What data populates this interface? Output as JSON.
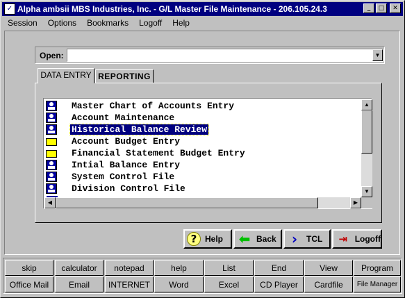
{
  "window": {
    "title": "Alpha ambsii MBS Industries, Inc. - G/L Master File Maintenance - 206.105.24.3",
    "minimize_glyph": "_",
    "maximize_glyph": "□",
    "close_glyph": "✕"
  },
  "menu": [
    "Session",
    "Options",
    "Bookmarks",
    "Logoff",
    "Help"
  ],
  "open": {
    "label": "Open:",
    "value": ""
  },
  "tabs": {
    "active": "DATA ENTRY",
    "inactive": "REPORTING"
  },
  "list": {
    "items": [
      {
        "label": "Master Chart of Accounts Entry",
        "icon": "database-icon"
      },
      {
        "label": "Account Maintenance",
        "icon": "database-icon"
      },
      {
        "label": "Historical Balance Review",
        "icon": "database-icon",
        "selected": true
      },
      {
        "label": "Account Budget Entry",
        "icon": "folder-icon"
      },
      {
        "label": "Financial Statement Budget Entry",
        "icon": "folder-icon"
      },
      {
        "label": "Intial Balance Entry",
        "icon": "database-icon"
      },
      {
        "label": "System Control File",
        "icon": "database-icon"
      },
      {
        "label": "Division Control File",
        "icon": "database-icon"
      }
    ]
  },
  "actions": {
    "help": "Help",
    "back": "Back",
    "tcl": "TCL",
    "logoff": "Logoff"
  },
  "launcher": {
    "row1": [
      "skip",
      "calculator",
      "notepad",
      "help",
      "List",
      "End",
      "View",
      "Program"
    ],
    "row2": [
      "Office Mail",
      "Email",
      "INTERNET",
      "Word",
      "Excel",
      "CD Player",
      "Cardfile",
      "File Manager"
    ]
  }
}
